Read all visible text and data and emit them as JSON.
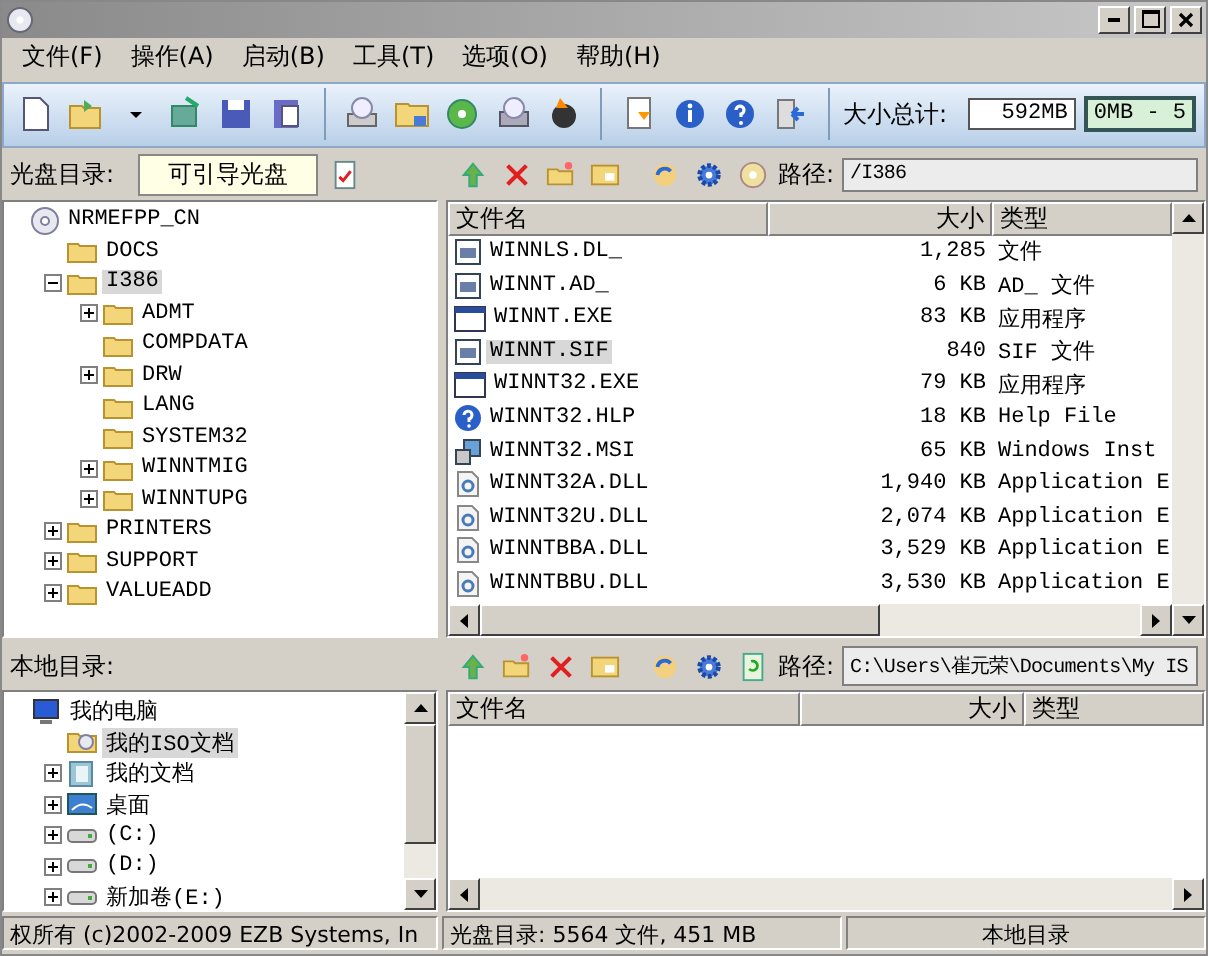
{
  "menu": [
    "文件(F)",
    "操作(A)",
    "启动(B)",
    "工具(T)",
    "选项(O)",
    "帮助(H)"
  ],
  "toolbar": {
    "size_label": "大小总计:",
    "size_value": "592MB",
    "capacity": "0MB - 5"
  },
  "iso_pane": {
    "label": "光盘目录:",
    "volume": "可引导光盘",
    "tree": [
      {
        "name": "NRMEFPP_CN",
        "kind": "cd",
        "selected": false,
        "children": [
          {
            "name": "DOCS",
            "kind": "folder",
            "selected": false
          },
          {
            "name": "I386",
            "kind": "folder",
            "selected": true,
            "expanded": true,
            "children": [
              {
                "name": "ADMT",
                "kind": "folder",
                "selected": false,
                "expanded": false
              },
              {
                "name": "COMPDATA",
                "kind": "folder",
                "selected": false
              },
              {
                "name": "DRW",
                "kind": "folder",
                "selected": false,
                "expanded": false
              },
              {
                "name": "LANG",
                "kind": "folder",
                "selected": false
              },
              {
                "name": "SYSTEM32",
                "kind": "folder",
                "selected": false
              },
              {
                "name": "WINNTMIG",
                "kind": "folder",
                "selected": false,
                "expanded": false
              },
              {
                "name": "WINNTUPG",
                "kind": "folder",
                "selected": false,
                "expanded": false
              }
            ]
          },
          {
            "name": "PRINTERS",
            "kind": "folder",
            "selected": false,
            "expanded": false
          },
          {
            "name": "SUPPORT",
            "kind": "folder",
            "selected": false,
            "expanded": false
          },
          {
            "name": "VALUEADD",
            "kind": "folder",
            "selected": false,
            "expanded": false
          }
        ]
      }
    ],
    "path_label": "路径:",
    "path": "/I386",
    "columns": [
      "文件名",
      "大小",
      "类型"
    ],
    "rows": [
      {
        "name": "WINNLS.DL_",
        "size": "1,285",
        "type": "文件",
        "kind": "file",
        "selected": false
      },
      {
        "name": "WINNT.AD_",
        "size": "6 KB",
        "type": "AD_ 文件",
        "kind": "file",
        "selected": false
      },
      {
        "name": "WINNT.EXE",
        "size": "83 KB",
        "type": "应用程序",
        "kind": "exe",
        "selected": false
      },
      {
        "name": "WINNT.SIF",
        "size": "840",
        "type": "SIF 文件",
        "kind": "file",
        "selected": true
      },
      {
        "name": "WINNT32.EXE",
        "size": "79 KB",
        "type": "应用程序",
        "kind": "exe",
        "selected": false
      },
      {
        "name": "WINNT32.HLP",
        "size": "18 KB",
        "type": "Help File",
        "kind": "help",
        "selected": false
      },
      {
        "name": "WINNT32.MSI",
        "size": "65 KB",
        "type": "Windows Inst",
        "kind": "msi",
        "selected": false
      },
      {
        "name": "WINNT32A.DLL",
        "size": "1,940 KB",
        "type": "Application E",
        "kind": "dll",
        "selected": false
      },
      {
        "name": "WINNT32U.DLL",
        "size": "2,074 KB",
        "type": "Application E",
        "kind": "dll",
        "selected": false
      },
      {
        "name": "WINNTBBA.DLL",
        "size": "3,529 KB",
        "type": "Application E",
        "kind": "dll",
        "selected": false
      },
      {
        "name": "WINNTBBU.DLL",
        "size": "3,530 KB",
        "type": "Application E",
        "kind": "dll",
        "selected": false
      }
    ]
  },
  "local_pane": {
    "label": "本地目录:",
    "tree": [
      {
        "name": "我的电脑",
        "kind": "computer",
        "selected": false,
        "children": [
          {
            "name": "我的ISO文档",
            "kind": "isodocs",
            "selected": true
          },
          {
            "name": "我的文档",
            "kind": "docs",
            "selected": false,
            "expanded": false
          },
          {
            "name": "桌面",
            "kind": "desktop",
            "selected": false,
            "expanded": false
          },
          {
            "name": "(C:)",
            "kind": "drive",
            "selected": false,
            "expanded": false
          },
          {
            "name": "(D:)",
            "kind": "drive",
            "selected": false,
            "expanded": false
          },
          {
            "name": "新加卷(E:)",
            "kind": "drive",
            "selected": false,
            "expanded": false
          }
        ]
      }
    ],
    "path_label": "路径:",
    "path": "C:\\Users\\崔元荣\\Documents\\My IS",
    "columns": [
      "文件名",
      "大小",
      "类型"
    ]
  },
  "status_bar": [
    "权所有 (c)2002-2009 EZB Systems, In",
    "光盘目录: 5564 文件, 451 MB",
    "本地目录"
  ]
}
